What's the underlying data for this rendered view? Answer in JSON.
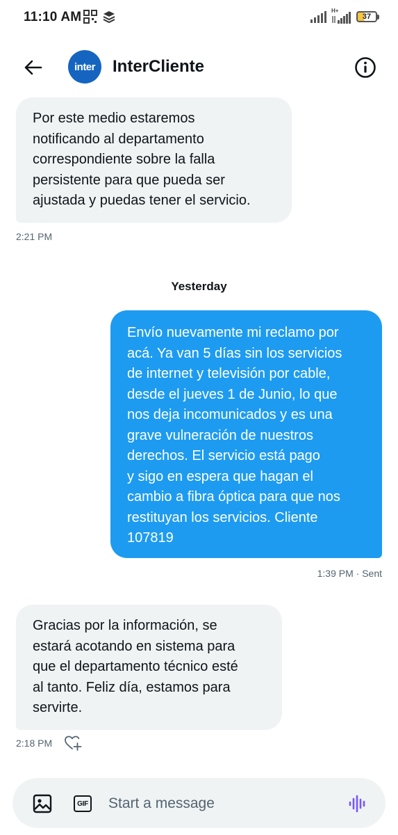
{
  "status_bar": {
    "time": "11:10 AM",
    "network_label": "H+",
    "battery_level": "37",
    "icons": [
      "qr-code-icon",
      "layers-icon",
      "signal-icon",
      "signal-h-plus-icon",
      "battery-icon"
    ]
  },
  "header": {
    "title": "InterCliente",
    "avatar_text": "inter",
    "avatar_color": "#1565c0",
    "icons": [
      "back-arrow-icon",
      "info-icon"
    ]
  },
  "messages": [
    {
      "direction": "incoming",
      "lines": [
        "Por este medio estaremos",
        "notificando al departamento",
        "correspondiente sobre la falla",
        "persistente para que pueda ser",
        "ajustada y puedas tener el servicio."
      ],
      "time": "2:21 PM"
    },
    {
      "direction": "outgoing",
      "lines": [
        "Envío nuevamente mi reclamo por",
        "acá. Ya van 5 días sin los servicios",
        "de internet y televisión por cable,",
        "desde el jueves 1 de Junio, lo que",
        "nos deja incomunicados y es una",
        "grave vulneración de nuestros",
        "derechos. El servicio está pago",
        "y sigo en espera que hagan el",
        "cambio a fibra óptica para que nos",
        "restituyan los servicios. Cliente",
        "107819"
      ],
      "time": "1:39 PM · Sent"
    },
    {
      "direction": "incoming",
      "lines": [
        "Gracias por la información, se",
        "estará acotando en sistema para",
        "que el departamento técnico esté",
        "al tanto. Feliz día, estamos para",
        "servirte."
      ],
      "time": "2:18 PM"
    }
  ],
  "day_separator": "Yesterday",
  "composer": {
    "placeholder": "Start a message",
    "gif_label": "GIF",
    "icons": [
      "image-icon",
      "gif-icon",
      "voice-icon",
      "heart-plus-icon"
    ]
  },
  "colors": {
    "outgoing_bubble": "#1d9bf0",
    "incoming_bubble": "#eff3f4",
    "voice_icon": "#7856ff",
    "meta_text": "#536471"
  }
}
